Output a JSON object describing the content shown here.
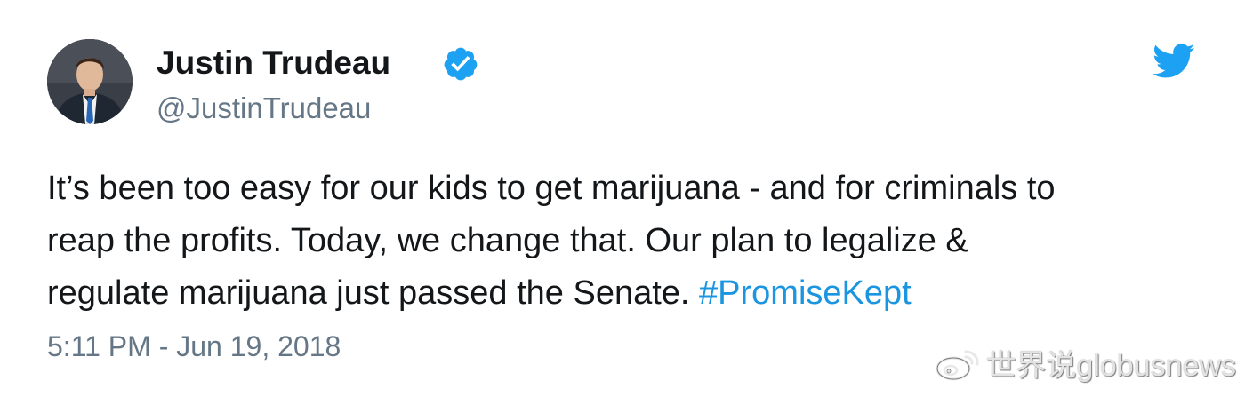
{
  "tweet": {
    "display_name": "Justin Trudeau",
    "handle": "@JustinTrudeau",
    "text_lines": [
      "It’s been too easy for our kids to get marijuana - and for criminals to",
      "reap the profits. Today, we change that. Our plan to legalize &",
      "regulate marijuana just passed the Senate. "
    ],
    "hashtag": "#PromiseKept",
    "timestamp": "5:11 PM - Jun 19, 2018",
    "verified": true
  },
  "icons": {
    "verified": "verified-badge-icon",
    "brand": "twitter-bird-icon",
    "watermark": "weibo-logo-icon"
  },
  "watermark": {
    "text": "世界说globusnews"
  },
  "colors": {
    "verified_blue": "#1da1f2",
    "hashtag_blue": "#1b95e0",
    "secondary_text": "#657786",
    "primary_text": "#14171a"
  }
}
